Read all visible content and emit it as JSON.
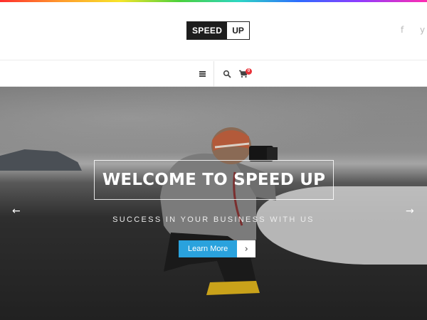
{
  "header": {
    "logo_left": "SPEED",
    "logo_right": "UP",
    "social": [
      {
        "icon": "facebook-icon",
        "glyph": "f"
      },
      {
        "icon": "twitter-icon",
        "glyph": "y"
      }
    ]
  },
  "nav": {
    "icons": [
      "menu-icon",
      "search-icon",
      "cart-icon"
    ],
    "cart_count": "0"
  },
  "hero": {
    "title": "WELCOME TO SPEED UP",
    "subtitle": "SUCCESS IN YOUR BUSINESS WITH US",
    "cta_label": "Learn More",
    "cta_arrow": "›",
    "prev_arrow": "←",
    "next_arrow": "→"
  },
  "colors": {
    "accent": "#2aa2dd",
    "badge": "#e8343b",
    "logo_dark": "#1d1d1d"
  }
}
